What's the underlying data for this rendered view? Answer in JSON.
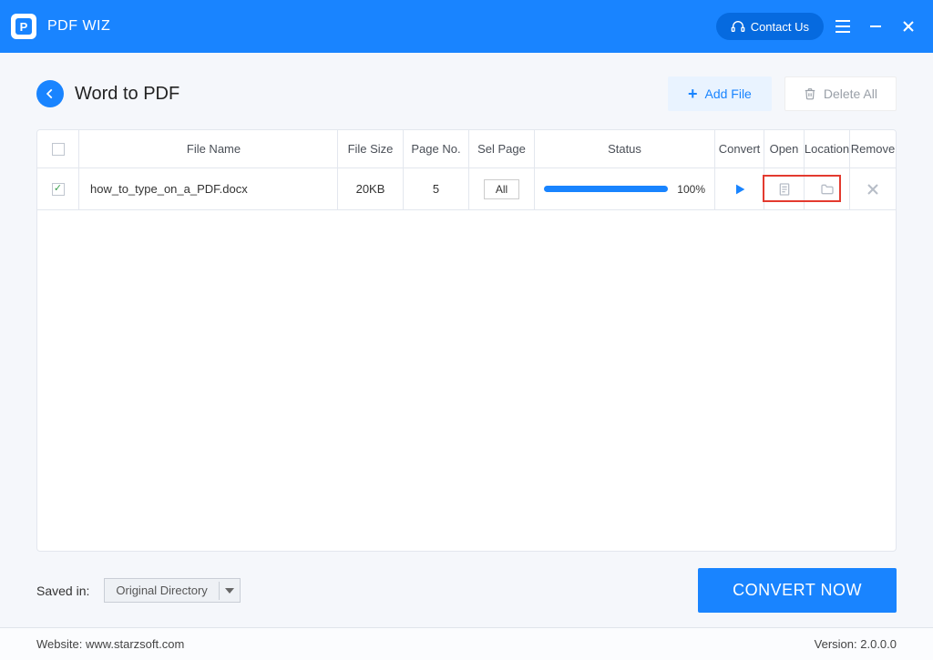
{
  "titlebar": {
    "app_name": "PDF WIZ",
    "contact_label": "Contact Us"
  },
  "header": {
    "title": "Word to PDF",
    "add_file_label": "Add File",
    "delete_all_label": "Delete All"
  },
  "table": {
    "columns": {
      "file_name": "File Name",
      "file_size": "File Size",
      "page_no": "Page No.",
      "sel_page": "Sel Page",
      "status": "Status",
      "convert": "Convert",
      "open": "Open",
      "location": "Location",
      "remove": "Remove"
    },
    "rows": [
      {
        "checked": true,
        "file_name": "how_to_type_on_a_PDF.docx",
        "file_size": "20KB",
        "page_no": "5",
        "sel_page": "All",
        "progress_pct": "100%"
      }
    ]
  },
  "footer_controls": {
    "saved_in_label": "Saved in:",
    "saved_in_value": "Original Directory",
    "convert_label": "CONVERT NOW"
  },
  "status_footer": {
    "website_label": "Website: www.starzsoft.com",
    "version_label": "Version: 2.0.0.0"
  }
}
